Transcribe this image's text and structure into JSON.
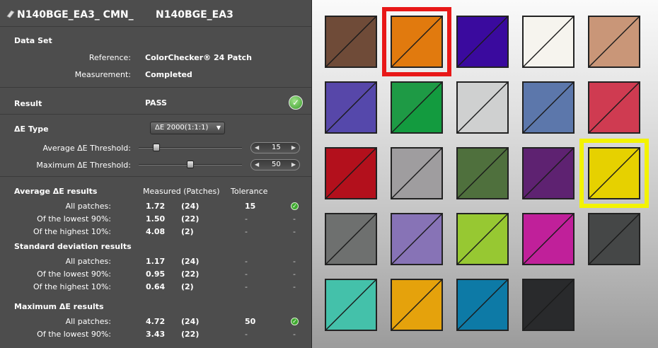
{
  "header": {
    "title_left": "N140BGE_EA3_ CMN_",
    "title_right": "N140BGE_EA3"
  },
  "dataset": {
    "heading": "Data Set",
    "reference_label": "Reference:",
    "reference_value": "ColorChecker® 24 Patch",
    "measurement_label": "Measurement:",
    "measurement_value": "Completed"
  },
  "result": {
    "heading": "Result",
    "value": "PASS"
  },
  "delta_e": {
    "heading": "ΔE Type",
    "type_value": "ΔE 2000(1:1:1)",
    "avg_label": "Average  ΔE Threshold:",
    "avg_value": "15",
    "avg_level": 0.15,
    "max_label": "Maximum ΔE Threshold:",
    "max_value": "50",
    "max_level": 0.5
  },
  "columns": {
    "measured": "Measured (Patches)",
    "tolerance": "Tolerance"
  },
  "avg_results": {
    "heading": "Average ΔE results",
    "rows": [
      {
        "label": "All patches:",
        "value": "1.72",
        "count": "(24)",
        "tolerance": "15",
        "status": "check"
      },
      {
        "label": "Of the lowest 90%:",
        "value": "1.50",
        "count": "(22)",
        "tolerance": "-",
        "status": "-"
      },
      {
        "label": "Of the highest 10%:",
        "value": "4.08",
        "count": "(2)",
        "tolerance": "-",
        "status": "-"
      }
    ]
  },
  "std_results": {
    "heading": "Standard deviation results",
    "rows": [
      {
        "label": "All patches:",
        "value": "1.17",
        "count": "(24)",
        "tolerance": "-",
        "status": "-"
      },
      {
        "label": "Of the lowest 90%:",
        "value": "0.95",
        "count": "(22)",
        "tolerance": "-",
        "status": "-"
      },
      {
        "label": "Of the highest 10%:",
        "value": "0.64",
        "count": "(2)",
        "tolerance": "-",
        "status": "-"
      }
    ]
  },
  "max_results": {
    "heading": "Maximum ΔE results",
    "rows": [
      {
        "label": "All patches:",
        "value": "4.72",
        "count": "(24)",
        "tolerance": "50",
        "status": "check"
      },
      {
        "label": "Of the lowest 90%:",
        "value": "3.43",
        "count": "(22)",
        "tolerance": "-",
        "status": "-"
      }
    ]
  },
  "patches": [
    {
      "top": "#6f4b38",
      "bot": "#6f4b38",
      "hl": ""
    },
    {
      "top": "#e17a0e",
      "bot": "#e17a0e",
      "hl": "#e81818"
    },
    {
      "top": "#3a0a9e",
      "bot": "#3a0a9e",
      "hl": ""
    },
    {
      "top": "#f6f4ee",
      "bot": "#f6f4ee",
      "hl": ""
    },
    {
      "top": "#c99678",
      "bot": "#c99678",
      "hl": ""
    },
    {
      "top": "#5747a9",
      "bot": "#5548ab",
      "hl": ""
    },
    {
      "top": "#1e9a45",
      "bot": "#139b3f",
      "hl": ""
    },
    {
      "top": "#cfd0d0",
      "bot": "#cfd0d0",
      "hl": ""
    },
    {
      "top": "#5c77ab",
      "bot": "#5c77ab",
      "hl": ""
    },
    {
      "top": "#cf3b51",
      "bot": "#cf3b51",
      "hl": ""
    },
    {
      "top": "#b3101c",
      "bot": "#b3101c",
      "hl": ""
    },
    {
      "top": "#9f9d9f",
      "bot": "#9f9d9f",
      "hl": ""
    },
    {
      "top": "#4f703d",
      "bot": "#4f703d",
      "hl": ""
    },
    {
      "top": "#5e2271",
      "bot": "#5e2271",
      "hl": ""
    },
    {
      "top": "#e6d100",
      "bot": "#e6d100",
      "hl": "#f3f300"
    },
    {
      "top": "#6e706f",
      "bot": "#6e706f",
      "hl": ""
    },
    {
      "top": "#8773b6",
      "bot": "#8773b6",
      "hl": ""
    },
    {
      "top": "#97c832",
      "bot": "#97c832",
      "hl": ""
    },
    {
      "top": "#c0209a",
      "bot": "#c0209a",
      "hl": ""
    },
    {
      "top": "#454747",
      "bot": "#454747",
      "hl": ""
    },
    {
      "top": "#44c1aa",
      "bot": "#44c1aa",
      "hl": ""
    },
    {
      "top": "#e5a20c",
      "bot": "#e5a20c",
      "hl": ""
    },
    {
      "top": "#0d7aa6",
      "bot": "#0d7aa6",
      "hl": ""
    },
    {
      "top": "#292a2c",
      "bot": "#292a2c",
      "hl": ""
    }
  ]
}
